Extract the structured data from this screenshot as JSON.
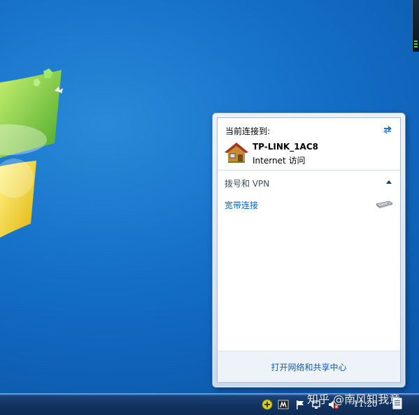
{
  "flyout": {
    "current_label": "当前连接到:",
    "network": {
      "name": "TP-LINK_1AC8",
      "status": "Internet 访问"
    },
    "dialup": {
      "title": "拨号和 VPN",
      "broadband_label": "宽带连接"
    },
    "footer_link": "打开网络和共享中心"
  },
  "taskbar": {
    "clock": "11:20"
  },
  "watermark": "知乎 @南风知我意",
  "icons": {
    "refresh": "refresh-arrows-icon",
    "network": "home-network-icon",
    "collapse": "chevron-up-icon",
    "modem": "modem-icon",
    "tray": [
      "add-plus-icon",
      "app-tray-icon",
      "action-center-flag-icon",
      "network-tray-icon",
      "volume-muted-icon"
    ]
  },
  "colors": {
    "link": "#0066cc",
    "footer_link": "#1a5aa8",
    "desktop": "#1570c8"
  }
}
